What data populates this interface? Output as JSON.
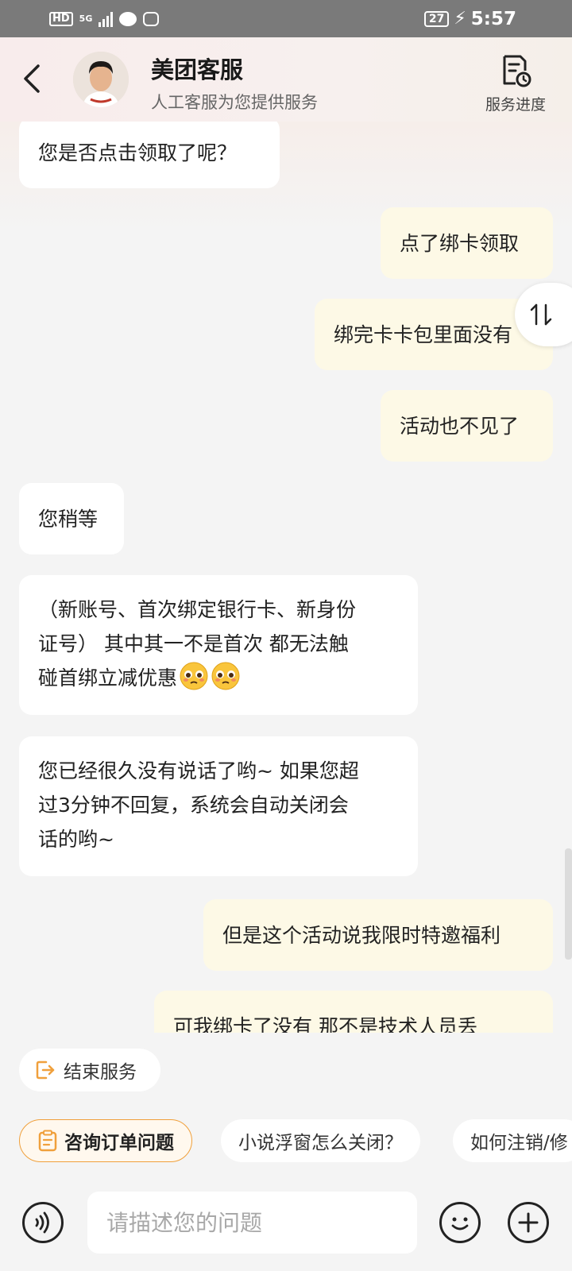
{
  "status_bar": {
    "hd": "HD",
    "network": "5G",
    "battery": "27",
    "time": "5:57"
  },
  "header": {
    "title": "美团客服",
    "subtitle": "人工客服为您提供服务",
    "progress_label": "服务进度"
  },
  "messages": [
    {
      "side": "left",
      "text": "您是否点击领取了呢？"
    },
    {
      "side": "right",
      "text": "点了绑卡领取"
    },
    {
      "side": "right",
      "text": "绑完卡卡包里面没有"
    },
    {
      "side": "right",
      "text": "活动也不见了"
    },
    {
      "side": "left",
      "text": "您稍等"
    },
    {
      "side": "left",
      "lines": [
        "（新账号、首次绑定银行卡、新身份",
        "证号） 其中其一不是首次 都无法触",
        "碰首绑立减优惠"
      ],
      "emoji": "pleading-face"
    },
    {
      "side": "left",
      "lines": [
        "您已经很久没有说话了哟~ 如果您超",
        "过3分钟不回复，系统会自动关闭会",
        "话的哟~"
      ]
    },
    {
      "side": "right",
      "text": "但是这个活动说我限时特邀福利"
    },
    {
      "side": "right",
      "text": "可我绑卡了没有 那不是技术人员丢"
    }
  ],
  "actions": {
    "end_service": "结束服务"
  },
  "quick_questions": [
    "咨询订单问题",
    "小说浮窗怎么关闭？",
    "如何注销/修"
  ],
  "input": {
    "placeholder": "请描述您的问题",
    "value": ""
  },
  "colors": {
    "accent": "#f0a03c",
    "right_bubble": "#fdf9e6",
    "left_bubble": "#ffffff",
    "background": "#f4f4f4"
  }
}
